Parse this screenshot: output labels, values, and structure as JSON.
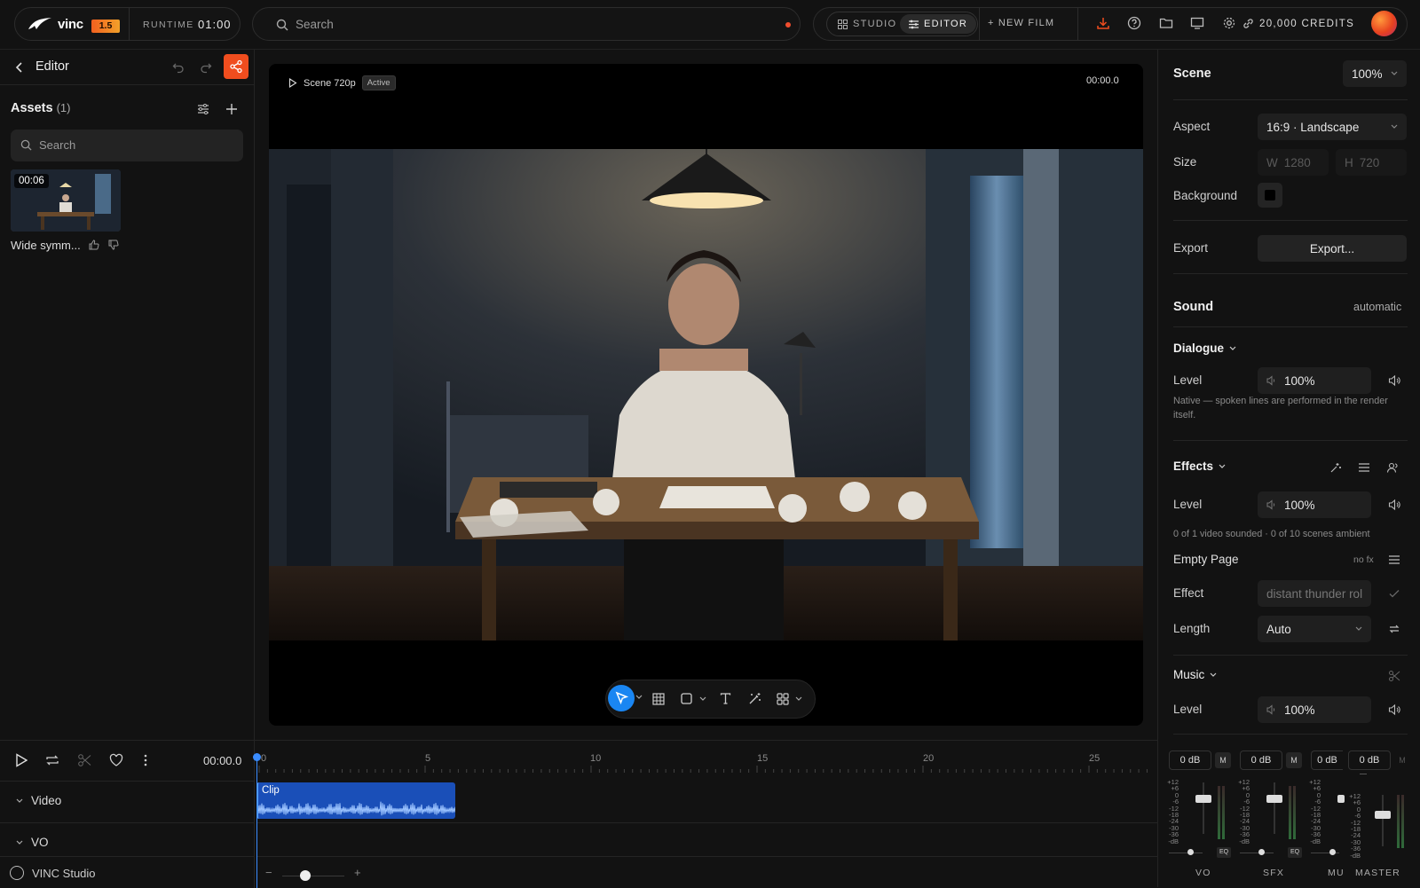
{
  "topbar": {
    "logo_text": "vinc",
    "version": "1.5",
    "runtime_label": "RUNTIME",
    "runtime_value": "01:00",
    "search_placeholder": "Search",
    "mode_studio": "STUDIO",
    "mode_editor": "EDITOR",
    "new_film": "+ NEW FILM",
    "credits": "20,000 CREDITS",
    "icons": [
      "download-icon",
      "help-icon",
      "folder-icon",
      "monitor-icon",
      "gear-icon",
      "link-icon"
    ],
    "accent": "#f04d1e"
  },
  "sidebar": {
    "title": "Editor",
    "assets_title": "Assets",
    "assets_count": "(1)",
    "search_placeholder": "Search",
    "asset": {
      "duration": "00:06",
      "name": "Wide symm..."
    }
  },
  "preview": {
    "scene_label": "Scene 720p",
    "badge": "Active",
    "time": "00:00.0"
  },
  "panel": {
    "scene": {
      "title": "Scene",
      "zoom": "100%",
      "aspect_label": "Aspect",
      "aspect_value": "16:9 · Landscape",
      "size_label": "Size",
      "width_prefix": "W",
      "width": "1280",
      "height_prefix": "H",
      "height": "720",
      "background_label": "Background",
      "export_label": "Export",
      "export_button": "Export..."
    },
    "sound": {
      "title": "Sound",
      "mode": "automatic"
    },
    "dialogue": {
      "title": "Dialogue",
      "level_label": "Level",
      "level": "100%",
      "note": "Native — spoken lines are performed in the render itself."
    },
    "effects": {
      "title": "Effects",
      "level_label": "Level",
      "level": "100%",
      "stats": "0 of 1 video sounded · 0 of 10 scenes ambient",
      "clip_name": "Empty Page",
      "clip_tag": "no fx",
      "effect_label": "Effect",
      "effect_placeholder": "distant thunder rol",
      "length_label": "Length",
      "length_value": "Auto"
    },
    "music": {
      "title": "Music",
      "level_label": "Level",
      "level": "100%"
    }
  },
  "timeline": {
    "time": "00:00.0",
    "tracks": [
      "Video",
      "VO"
    ],
    "studio_label": "VINC Studio",
    "ruler": [
      "0",
      "5",
      "10",
      "15",
      "20",
      "25"
    ],
    "clip_label": "Clip"
  },
  "mixer": {
    "scale": [
      "+12",
      "+6",
      "0",
      "-6",
      "-12",
      "-18",
      "-24",
      "-30",
      "-36"
    ],
    "db_unit": "-dB",
    "mute": "M",
    "eq": "EQ",
    "channels": [
      {
        "name": "VO",
        "db": "0 dB"
      },
      {
        "name": "SFX",
        "db": "0 dB"
      },
      {
        "name": "MUS",
        "db": "0 dB"
      },
      {
        "name": "MASTER",
        "db": "0 dB"
      }
    ]
  }
}
